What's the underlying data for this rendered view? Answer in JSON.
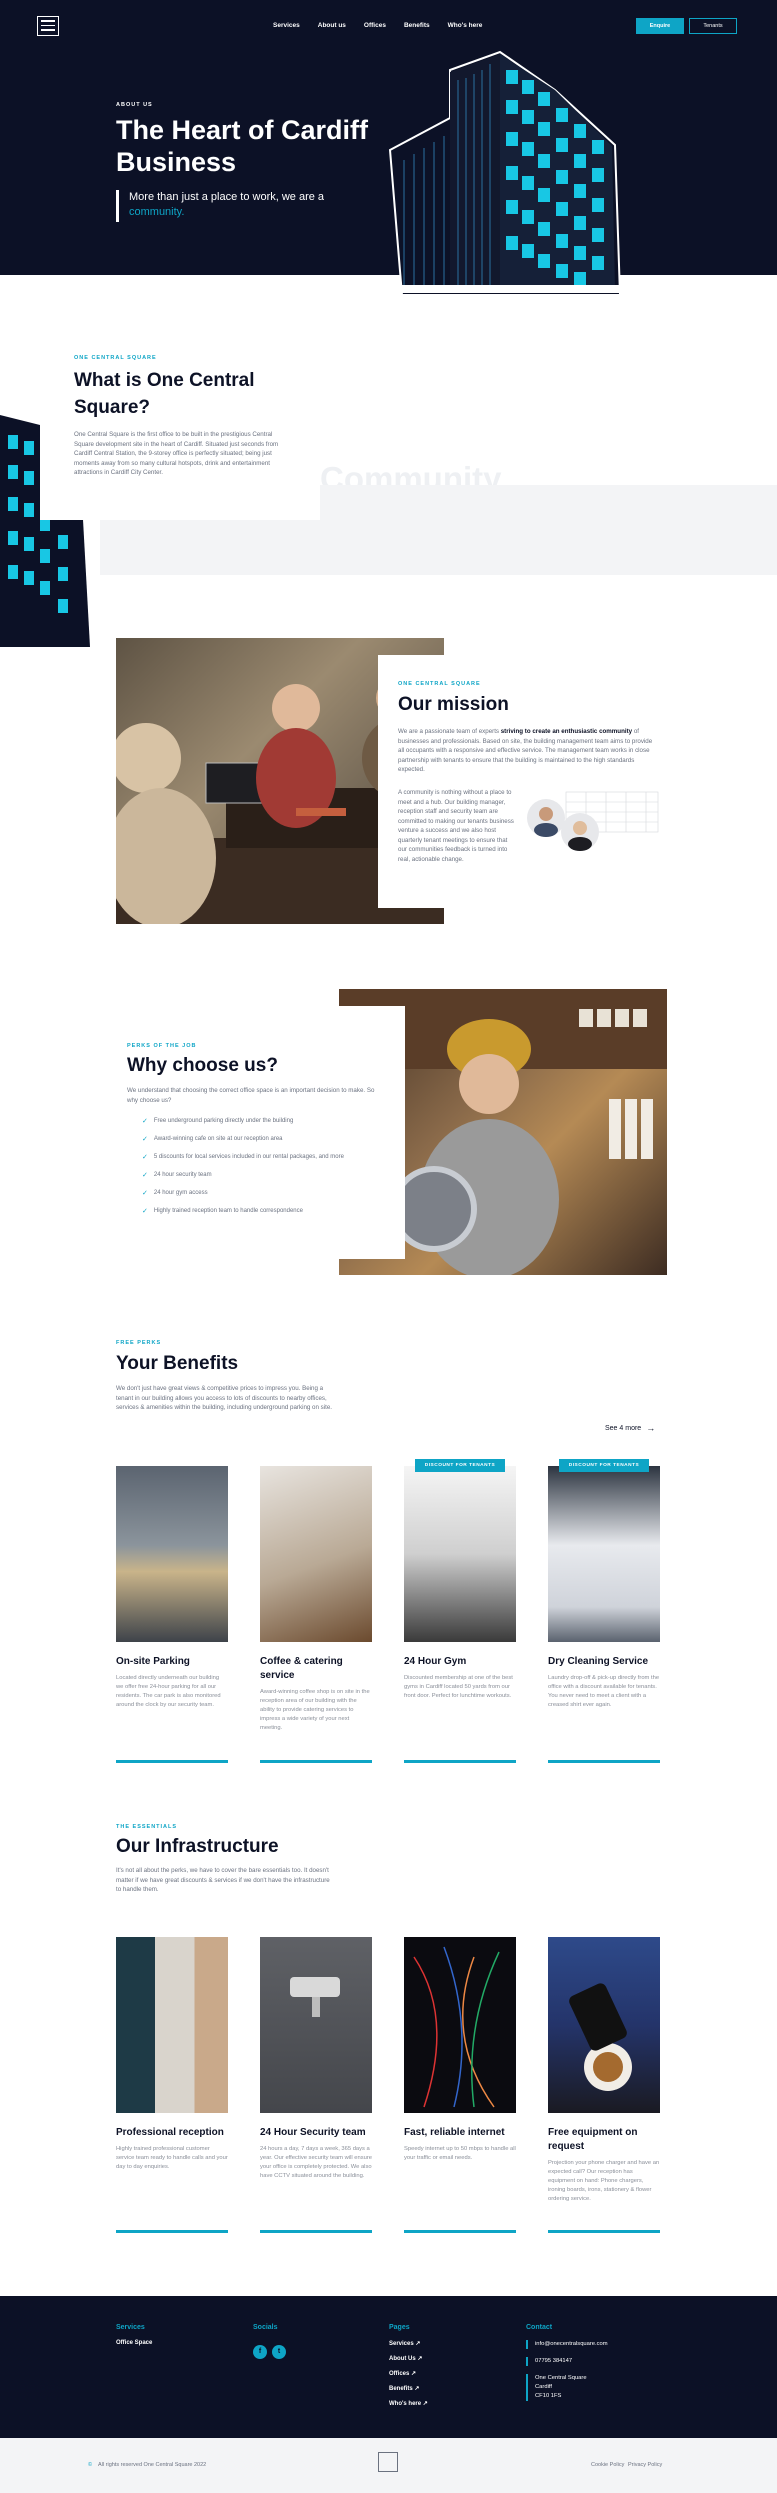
{
  "nav": {
    "items": [
      "Services",
      "About us",
      "Offices",
      "Benefits",
      "Who's here"
    ],
    "enquire_label": "Enquire",
    "tenants_label": "Tenants"
  },
  "hero": {
    "eyebrow": "ABOUT US",
    "title": "The Heart of Cardiff Business",
    "subtitle_plain": "More than just a place to work, we are a",
    "subtitle_accent": "community."
  },
  "what": {
    "eyebrow": "ONE CENTRAL SQUARE",
    "title": "What is One Central Square?",
    "body": "One Central Square is the first office to be built in the prestigious Central Square development site in the heart of Cardiff. Situated just seconds from Cardiff Central Station, the 9-storey office is perfectly situated; being just moments away from so many cultural hotspots, drink and entertainment attractions in Cardiff City Center.",
    "watermark": "Community"
  },
  "mission": {
    "eyebrow": "ONE CENTRAL SQUARE",
    "title": "Our mission",
    "p1_a": "We are a passionate team of experts ",
    "p1_b": "striving to create an enthusiastic community",
    "p1_c": " of businesses and professionals. Based on site, the building management team aims to provide all occupants with a responsive and effective service. The management team works in close partnership with tenants to ensure that the building is maintained to the high standards expected.",
    "p2": "A community is nothing without a place to meet and a hub. Our building manager, reception staff and security team are committed to making our tenants business venture a success and we also host quarterly tenant meetings to ensure that our communities feedback is turned into real, actionable change."
  },
  "why": {
    "eyebrow": "PERKS OF THE JOB",
    "title": "Why choose us?",
    "body": "We understand that choosing the correct office space is an important decision to make. So why choose us?",
    "items": [
      "Free underground parking directly under the building",
      "Award-winning cafe on site at our reception area",
      "5 discounts for local services included in our rental packages, and more",
      "24 hour security team",
      "24 hour gym access",
      "Highly trained reception team to handle correspondence"
    ]
  },
  "benefits": {
    "eyebrow": "FREE PERKS",
    "title": "Your Benefits",
    "body": "We don't just have great views & competitive prices to impress you. Being a tenant in our building allows you access to lots of discounts to nearby offices, services & amenities within the building, including underground parking on site.",
    "see_all": "See 4 more",
    "cards": [
      {
        "title": "On-site Parking",
        "desc": "Located directly underneath our building we offer free 24-hour parking for all our residents. The car park is also monitored around the clock by our security team.",
        "badge": ""
      },
      {
        "title": "Coffee & catering service",
        "desc": "Award-winning coffee shop is on site in the reception area of our building with the ability to provide catering services to impress a wide variety of your next meeting.",
        "badge": ""
      },
      {
        "title": "24 Hour Gym",
        "desc": "Discounted membership at one of the best gyms in Cardiff located 50 yards from our front door. Perfect for lunchtime workouts.",
        "badge": "DISCOUNT FOR TENANTS"
      },
      {
        "title": "Dry Cleaning Service",
        "desc": "Laundry drop-off & pick-up directly from the office with a discount available for tenants. You never need to meet a client with a creased shirt ever again.",
        "badge": "DISCOUNT FOR TENANTS"
      }
    ]
  },
  "infra": {
    "eyebrow": "THE ESSENTIALS",
    "title": "Our Infrastructure",
    "body": "It's not all about the perks, we have to cover the bare essentials too. It doesn't matter if we have great discounts & services if we don't have the infrastructure to handle them.",
    "cards": [
      {
        "title": "Professional reception",
        "desc": "Highly trained professional customer service team ready to handle calls and your day to day enquiries."
      },
      {
        "title": "24 Hour Security team",
        "desc": "24 hours a day, 7 days a week, 365 days a year. Our effective security team will ensure your office is completely protected. We also have CCTV situated around the building."
      },
      {
        "title": "Fast, reliable internet",
        "desc": "Speedy internet up to 50 mbps to handle all your traffic or email needs."
      },
      {
        "title": "Free equipment on request",
        "desc": "Projection your phone charger and have an expected call? Our reception has equipment on hand: Phone chargers, ironing boards, irons, stationery & flower ordering service."
      }
    ]
  },
  "footer": {
    "services_heading": "Services",
    "services_items": [
      "Office Space"
    ],
    "socials_heading": "Socials",
    "pages_heading": "Pages",
    "pages_items": [
      "Services ↗",
      "About Us ↗",
      "Offices ↗",
      "Benefits ↗",
      "Who's here ↗"
    ],
    "contact_heading": "Contact",
    "contact_items": [
      "info@onecentralsquare.com",
      "07795 384147",
      "One Central Square\nCardiff\nCF10 1FS"
    ]
  },
  "bottom": {
    "copyright": "All rights reserved One Central Square 2022",
    "cookie": "Cookie Policy",
    "privacy": "Privacy Policy"
  },
  "colors": {
    "accent": "#0ea5c6",
    "dark": "#0c1126"
  }
}
